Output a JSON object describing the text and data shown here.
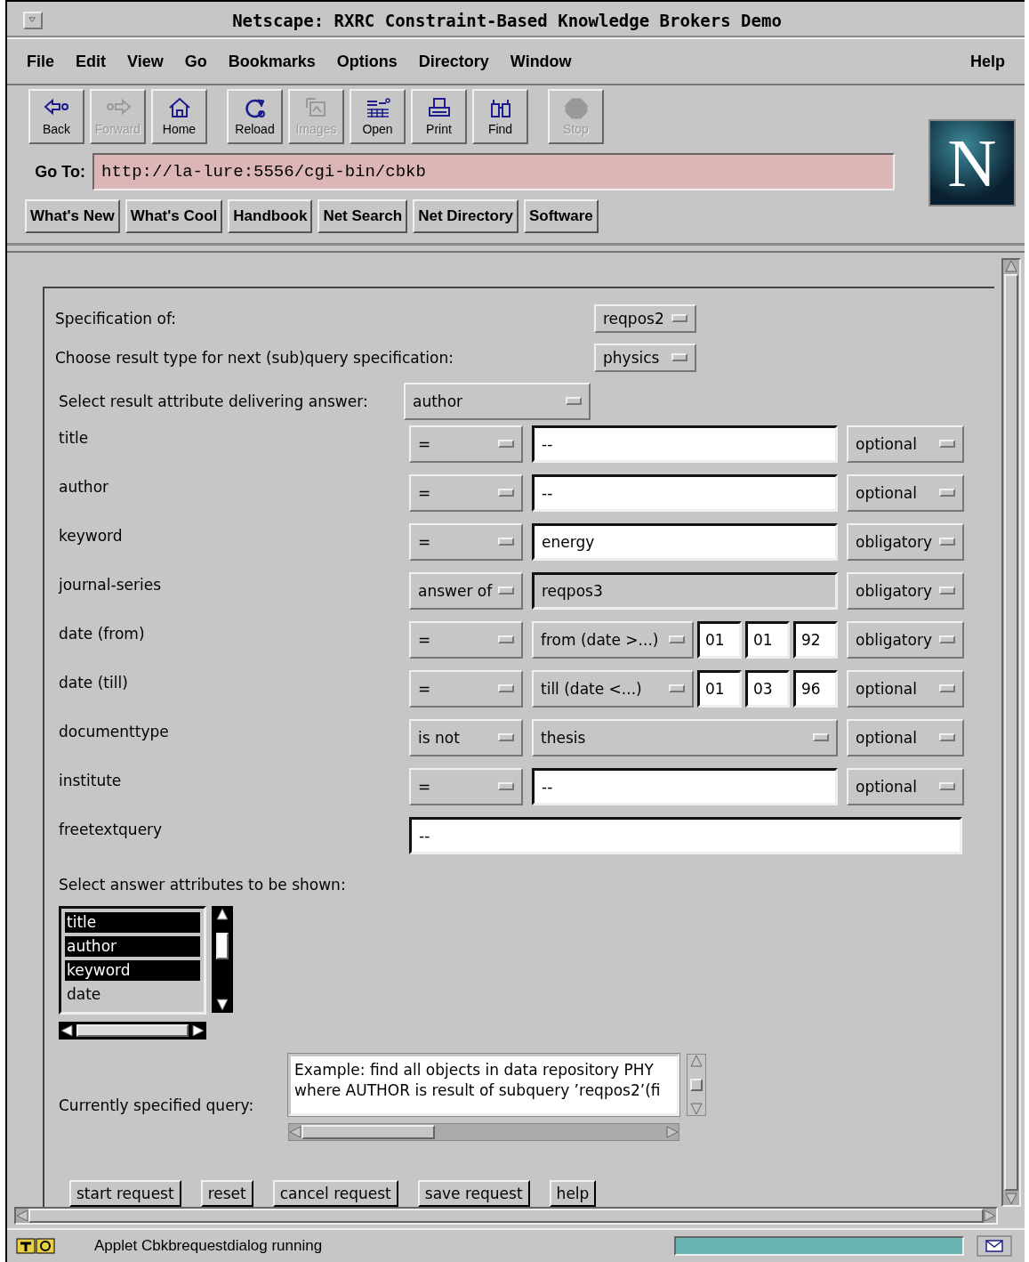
{
  "window": {
    "title": "Netscape: RXRC Constraint-Based Knowledge Brokers Demo"
  },
  "menu": {
    "items": [
      "File",
      "Edit",
      "View",
      "Go",
      "Bookmarks",
      "Options",
      "Directory",
      "Window"
    ],
    "help": "Help"
  },
  "toolbar": [
    {
      "buttons": [
        {
          "label": "Back",
          "kind": "back",
          "disabled": false
        },
        {
          "label": "Forward",
          "kind": "forward",
          "disabled": true
        },
        {
          "label": "Home",
          "kind": "home",
          "disabled": false
        }
      ]
    },
    {
      "buttons": [
        {
          "label": "Reload",
          "kind": "reload",
          "disabled": false
        },
        {
          "label": "Images",
          "kind": "images",
          "disabled": true
        },
        {
          "label": "Open",
          "kind": "open",
          "disabled": false
        },
        {
          "label": "Print",
          "kind": "print",
          "disabled": false
        },
        {
          "label": "Find",
          "kind": "find",
          "disabled": false
        }
      ]
    },
    {
      "buttons": [
        {
          "label": "Stop",
          "kind": "stop",
          "disabled": true
        }
      ]
    }
  ],
  "location": {
    "label": "Go To:",
    "value": "http://la-lure:5556/cgi-bin/cbkb"
  },
  "directory_buttons": [
    "What's New",
    "What's Cool",
    "Handbook",
    "Net Search",
    "Net Directory",
    "Software"
  ],
  "logo": "N",
  "form": {
    "specification": {
      "label": "Specification of:",
      "value": "reqpos2"
    },
    "result_type": {
      "label": "Choose result type for next (sub)query specification:",
      "value": "physics"
    },
    "result_attribute": {
      "label": "Select result attribute delivering answer:",
      "value": "author"
    },
    "rows": [
      {
        "label": "title",
        "kind": "text",
        "operator": "=",
        "value": "--",
        "requirement": "optional"
      },
      {
        "label": "author",
        "kind": "text",
        "operator": "=",
        "value": "--",
        "requirement": "optional"
      },
      {
        "label": "keyword",
        "kind": "text",
        "operator": "=",
        "value": "energy",
        "requirement": "obligatory"
      },
      {
        "label": "journal-series",
        "kind": "answer",
        "operator": "answer of",
        "value": "reqpos3",
        "requirement": "obligatory"
      },
      {
        "label": "date (from)",
        "kind": "date",
        "operator": "=",
        "qualifier": "from (date >...)",
        "date_parts": [
          "01",
          "01",
          "92"
        ],
        "requirement": "obligatory"
      },
      {
        "label": "date (till)",
        "kind": "date",
        "operator": "=",
        "qualifier": "till (date <...)",
        "date_parts": [
          "01",
          "03",
          "96"
        ],
        "requirement": "optional"
      },
      {
        "label": "documenttype",
        "kind": "choice",
        "operator": "is not",
        "value": "thesis",
        "requirement": "optional"
      },
      {
        "label": "institute",
        "kind": "text",
        "operator": "=",
        "value": "--",
        "requirement": "optional"
      }
    ],
    "freetext": {
      "label": "freetextquery",
      "value": "--"
    },
    "attributes": {
      "label": "Select answer attributes to be shown:",
      "items": [
        {
          "label": "title",
          "selected": true
        },
        {
          "label": "author",
          "selected": true
        },
        {
          "label": "keyword",
          "selected": true
        },
        {
          "label": "date",
          "selected": false
        }
      ]
    },
    "query": {
      "label": "Currently specified query:",
      "lines": [
        "Example: find all objects in data repository PHY",
        "where AUTHOR is result of subquery ’reqpos2’(fi"
      ]
    },
    "buttons": [
      "start request",
      "reset",
      "cancel request",
      "save request",
      "help"
    ]
  },
  "status_bar": {
    "text": "Applet Cbkbrequestdialog running",
    "progress": {
      "level": 1
    }
  }
}
